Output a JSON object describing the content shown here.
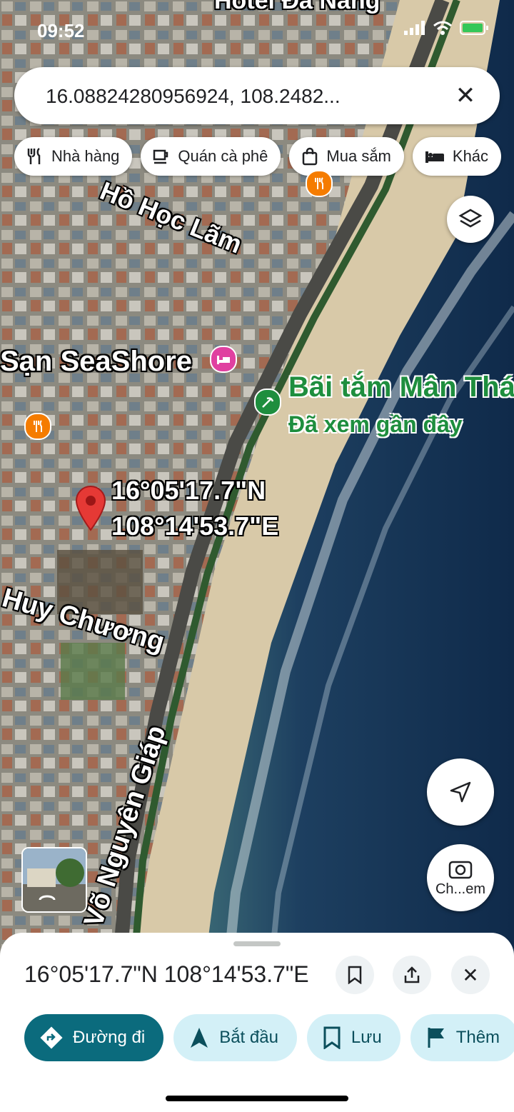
{
  "status_bar": {
    "time": "09:52"
  },
  "search": {
    "value": "16.08824280956924, 108.2482..."
  },
  "chips": [
    {
      "label": "Nhà hàng",
      "icon": "fork-knife-icon"
    },
    {
      "label": "Quán cà phê",
      "icon": "coffee-cup-icon"
    },
    {
      "label": "Mua sắm",
      "icon": "shopping-bag-icon"
    },
    {
      "label": "Khác",
      "icon": "bed-icon"
    }
  ],
  "map": {
    "top_label": "Hotel Đà Nẵng",
    "street_labels": {
      "ho_hoc_lam": "Hồ Học Lãm",
      "huy_chuong": "Huy Chương",
      "vo_nguyen_giap": "Võ Nguyên Giáp"
    },
    "hotel_label": "Sạn SeaShore",
    "beach": {
      "name": "Bãi tắm Mân Thái",
      "note": "Đã xem gần đây"
    },
    "pin_coords": {
      "lat": "16°05'17.7\"N",
      "lng": "108°14'53.7\"E"
    },
    "colors": {
      "pin": "#e53935",
      "restaurant": "#f57c00",
      "hotel": "#e040a0",
      "beach": "#1e8e3e"
    }
  },
  "fab": {
    "lens_label": "Ch...em"
  },
  "sheet": {
    "title": "16°05'17.7\"N 108°14'53.7\"E",
    "actions": [
      {
        "label": "Đường đi",
        "icon": "directions-icon"
      },
      {
        "label": "Bắt đầu",
        "icon": "navigate-arrow-icon"
      },
      {
        "label": "Lưu",
        "icon": "bookmark-icon"
      },
      {
        "label": "Thêm",
        "icon": "flag-icon"
      }
    ]
  }
}
